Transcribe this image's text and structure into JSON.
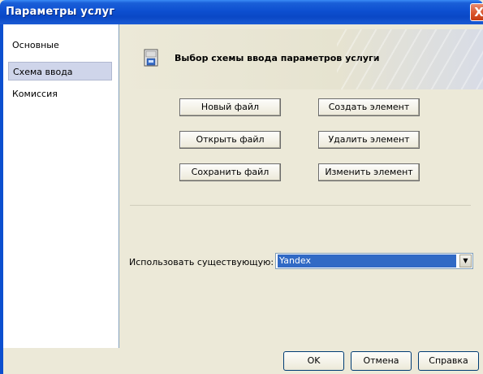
{
  "window": {
    "title": "Параметры услуг",
    "close_glyph": "X"
  },
  "sidebar": {
    "items": [
      {
        "label": "Основные",
        "selected": false
      },
      {
        "label": "Схема ввода",
        "selected": true
      },
      {
        "label": "Комиссия",
        "selected": false
      }
    ]
  },
  "main": {
    "header_icon": "floppy-document-icon",
    "header_title": "Выбор схемы ввода параметров услуги",
    "buttons": {
      "new_file": "Новый файл",
      "open_file": "Открыть файл",
      "save_file": "Сохранить файл",
      "create_element": "Создать элемент",
      "delete_element": "Удалить элемент",
      "edit_element": "Изменить элемент"
    },
    "use_existing": {
      "label": "Использовать существующую:",
      "value": "Yandex"
    }
  },
  "footer": {
    "ok": "OK",
    "cancel": "Отмена",
    "help": "Справка"
  },
  "colors": {
    "titlebar": "#0a48c6",
    "selection": "#316ac5",
    "panel": "#ece9d8",
    "nav_selected": "#cfd5ea"
  }
}
